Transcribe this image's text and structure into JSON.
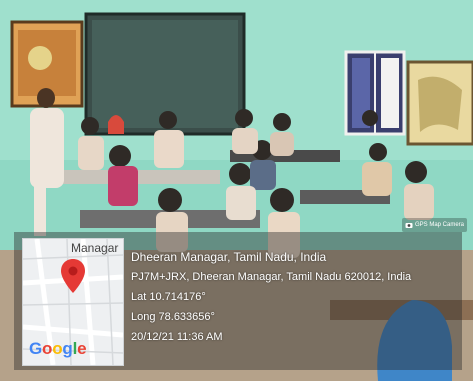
{
  "map": {
    "area_label": "Managar",
    "provider_logo": {
      "letters": [
        "G",
        "o",
        "o",
        "g",
        "l",
        "e"
      ],
      "colors": [
        "#4285f4",
        "#ea4335",
        "#fbbc05",
        "#4285f4",
        "#34a853",
        "#ea4335"
      ]
    },
    "pin_icon": "map-pin-icon",
    "pin_color": "#e53935"
  },
  "location": {
    "place": "Dheeran Managar, Tamil Nadu, India",
    "address": "PJ7M+JRX, Dheeran Managar, Tamil Nadu 620012, India",
    "latitude": "Lat 10.714176°",
    "longitude": "Long 78.633656°",
    "timestamp": "20/12/21 11:36 AM"
  },
  "app_badge": {
    "label": "GPS Map Camera",
    "icon": "camera-icon"
  },
  "photo": {
    "description": "",
    "wall_color": "#8fd8c4"
  }
}
